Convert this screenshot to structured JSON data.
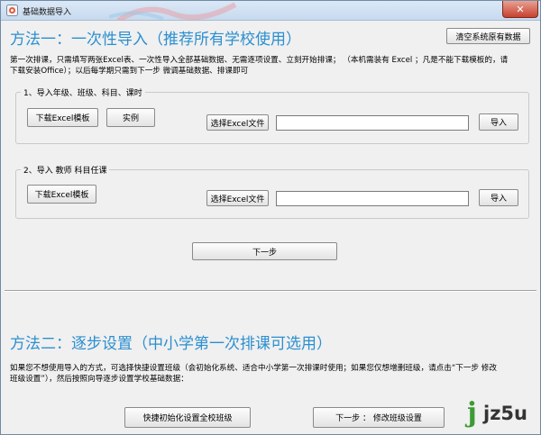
{
  "window": {
    "title": "基础数据导入",
    "icons": {
      "app": "app-icon",
      "close": "close-icon"
    }
  },
  "method1": {
    "heading": "方法一：一次性导入（推荐所有学校使用）",
    "clear_button": "清空系统原有数据",
    "desc_line1": "第一次排课，只需填写两张Excel表、一次性导入全部基础数据、无需逐项设置、立刻开始排课；  （本机需装有 Excel ；凡是不能下载模板的，请",
    "desc_line2": "下载安装Office）；以后每学期只需到下一步 微调基础数据、排课即可",
    "group1": {
      "legend": "1、导入年级、班级、科目、课时",
      "download_button": "下载Excel模板",
      "example_button": "实例",
      "choose_button": "选择Excel文件",
      "file_value": "",
      "import_button": "导入"
    },
    "group2": {
      "legend": "2、导入 教师 科目任课",
      "download_button": "下载Excel模板",
      "choose_button": "选择Excel文件",
      "file_value": "",
      "import_button": "导入"
    },
    "next_button": "下一步"
  },
  "method2": {
    "heading": "方法二：逐步设置（中小学第一次排课可选用）",
    "desc_line1": "如果您不想使用导入的方式，可选择快捷设置班级（会初始化系统、适合中小学第一次排课时使用；如果您仅想增删班级，请点击“下一步 修改",
    "desc_line2": "班级设置”），然后按照向导逐步设置学校基础数据：",
    "quick_button": "快捷初始化设置全校班级",
    "next_modify_button": "下一步 ： 修改班级设置"
  },
  "watermark": {
    "logo_j": "j",
    "logo_rest": "jz5u",
    "logo_icon": "jz5u-logo-icon"
  }
}
